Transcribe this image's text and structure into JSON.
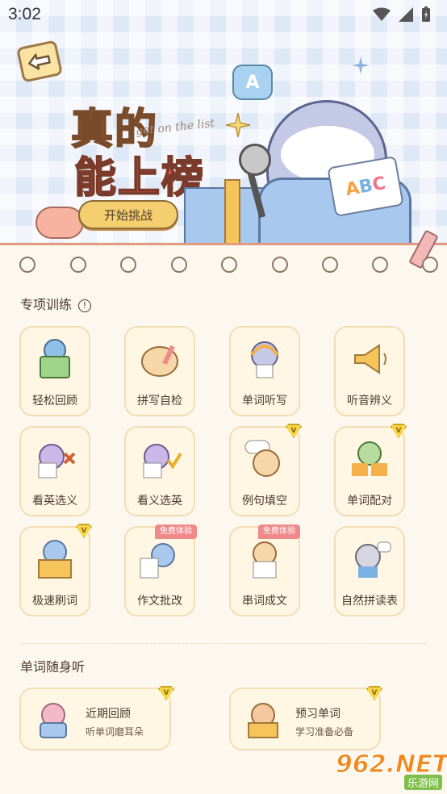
{
  "status_bar": {
    "time": "3:02"
  },
  "hero": {
    "title_line1": "真的",
    "title_line2": "能上榜",
    "script_text": "get on the list",
    "start_button": "开始挑战",
    "bubble_letter": "A",
    "card_letters": [
      "A",
      "B",
      "C"
    ]
  },
  "training": {
    "title": "专项训练",
    "info_symbol": "!",
    "items": [
      {
        "label": "轻松回顾",
        "badge": ""
      },
      {
        "label": "拼写自检",
        "badge": ""
      },
      {
        "label": "单词听写",
        "badge": ""
      },
      {
        "label": "听音辨义",
        "badge": ""
      },
      {
        "label": "看英选义",
        "badge": ""
      },
      {
        "label": "看义选英",
        "badge": ""
      },
      {
        "label": "例句填空",
        "badge": "V"
      },
      {
        "label": "单词配对",
        "badge": "V"
      },
      {
        "label": "极速刷词",
        "badge": "V"
      },
      {
        "label": "作文批改",
        "badge": "免费体验"
      },
      {
        "label": "串词成文",
        "badge": "免费体验"
      },
      {
        "label": "自然拼读表",
        "badge": ""
      }
    ]
  },
  "listen": {
    "title": "单词随身听",
    "items": [
      {
        "title": "近期回顾",
        "subtitle": "听单词磨耳朵",
        "badge": "V"
      },
      {
        "title": "预习单词",
        "subtitle": "学习准备必备",
        "badge": "V"
      }
    ]
  },
  "watermark": {
    "main": "962.NET",
    "sub": "乐游网"
  },
  "colors": {
    "background": "#fdf8ef",
    "card": "#fff7e3",
    "card_border": "#f3deb3",
    "vip_gold": "#f7d64a",
    "free_red": "#f08a8a"
  }
}
